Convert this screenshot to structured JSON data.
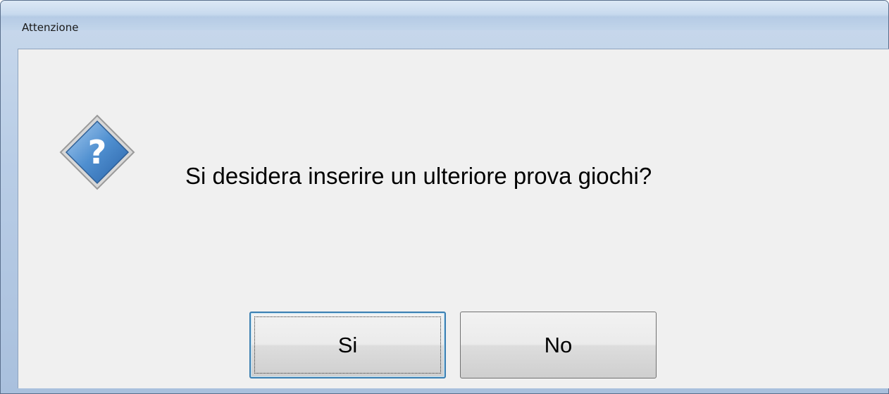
{
  "dialog": {
    "title": "Attenzione",
    "icon": "question-icon",
    "message": "Si desidera inserire un ulteriore prova giochi?",
    "buttons": {
      "yes_label": "Si",
      "no_label": "No"
    }
  },
  "colors": {
    "icon_blue": "#4a86c8",
    "default_button_border": "#3c7fb1"
  }
}
